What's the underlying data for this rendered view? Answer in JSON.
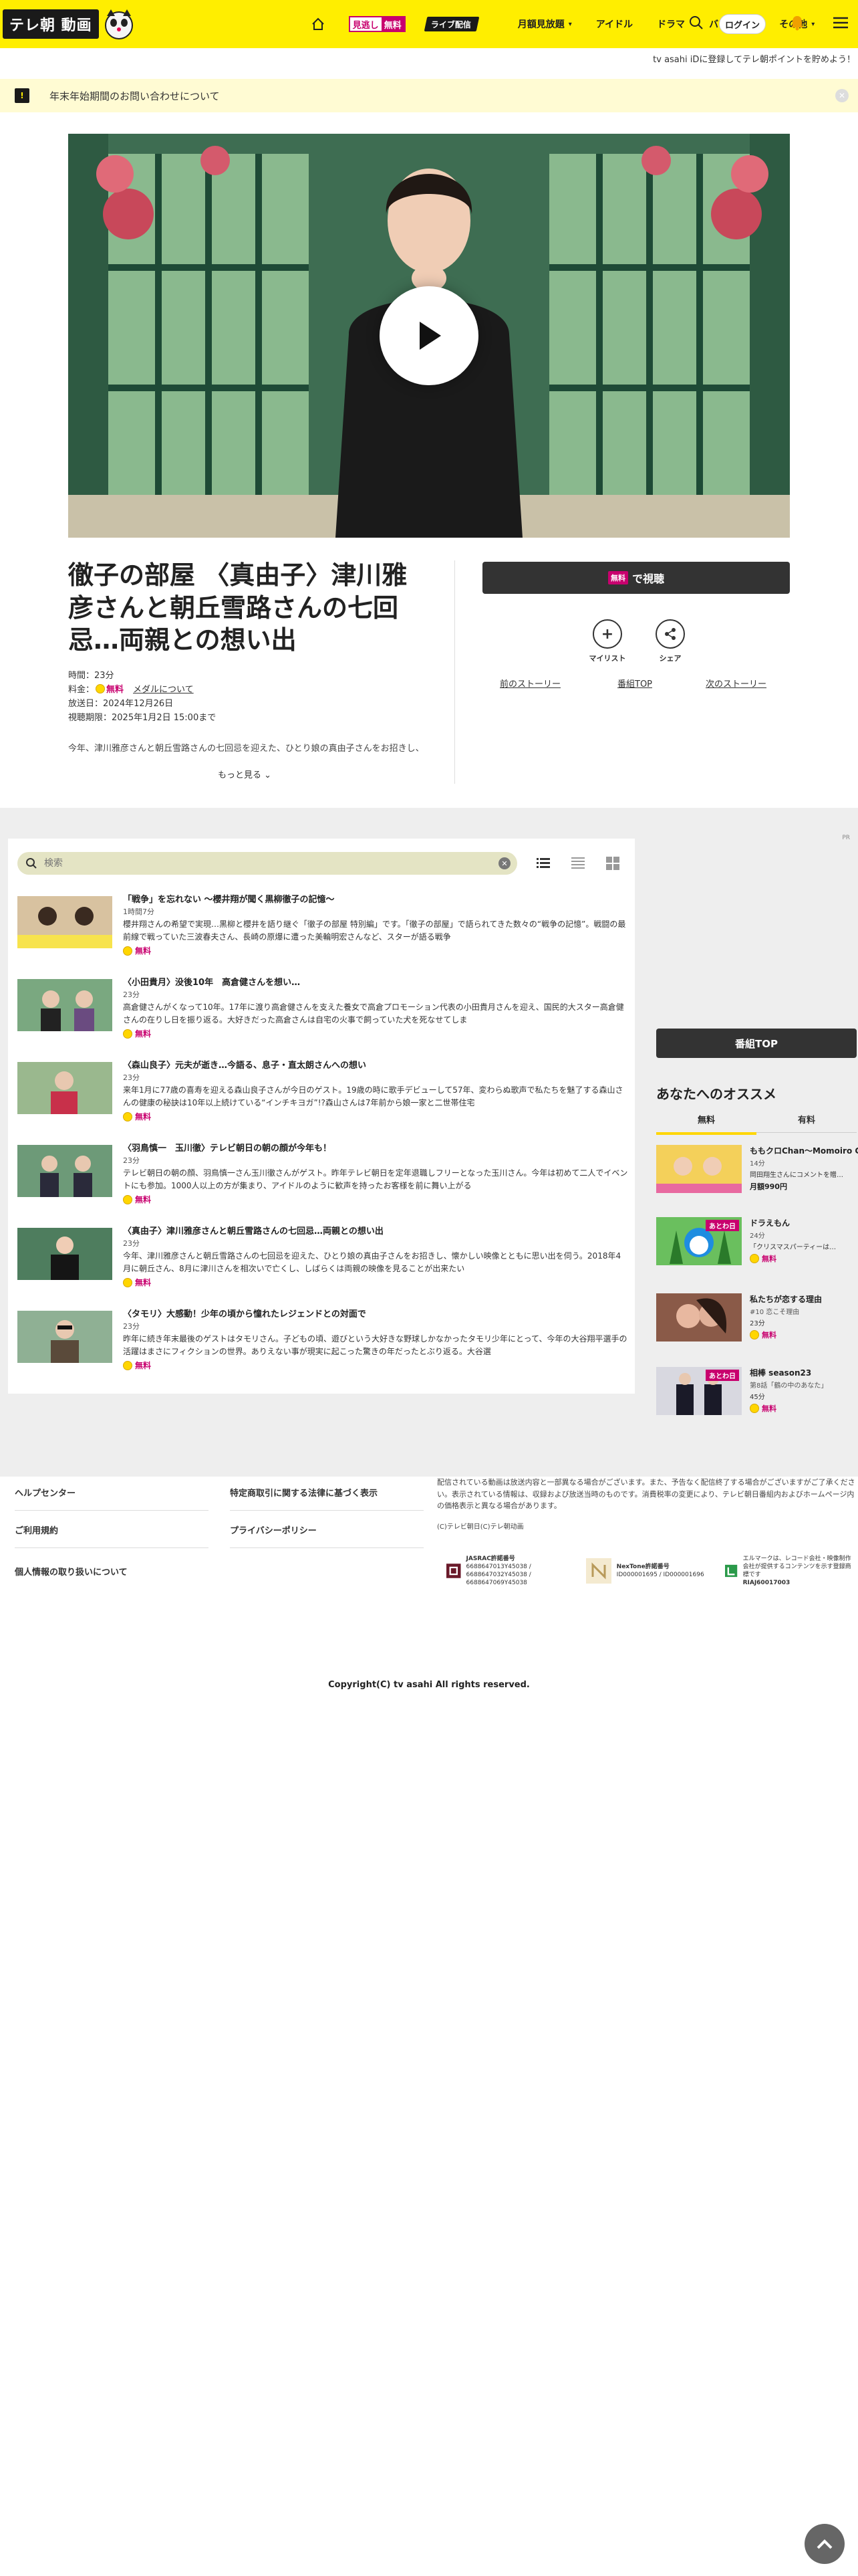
{
  "header": {
    "logo_text": "テレ朝 動画",
    "free_badge_a": "見逃し",
    "free_badge_b": "無料",
    "live_badge": "ライブ配信",
    "nav": [
      "月額見放題",
      "アイドル",
      "ドラマ",
      "バラエティ",
      "その他"
    ],
    "login": "ログイン"
  },
  "register_strip": "tv asahi iDに登録してテレ朝ポイントを貯めよう！",
  "notice": {
    "text": "年末年始期間のお問い合わせについて"
  },
  "episode": {
    "title": "徹子の部屋 〈真由子〉津川雅彦さんと朝丘雪路さんの七回忌…両親との想い出",
    "duration_label": "時間：23分",
    "price_label": "料金：",
    "price_value": "無料",
    "coin_link": "メダルについて",
    "air_date": "放送日：2024年12月26日",
    "deadline": "視聴期限：2025年1月2日 15:00まで",
    "description": "今年、津川雅彦さんと朝丘雪路さんの七回忌を迎えた、ひとり娘の真由子さんをお招きし、",
    "more": "もっと見る"
  },
  "actions": {
    "watch_badge": "無料",
    "watch_label": "で視聴",
    "mylist": "マイリスト",
    "share": "シェア",
    "prev": "前のストーリー",
    "top": "番組TOP",
    "next": "次のストーリー"
  },
  "pr_label": "PR",
  "search": {
    "placeholder": "検索"
  },
  "episodes": [
    {
      "title": "「戦争」を忘れない ～櫻井翔が聞く黒柳徹子の記憶～",
      "date": "1時間7分",
      "summary": "櫻井翔さんの希望で実現…黒柳と櫻井を語り継ぐ「徹子の部屋 特別編」です。「徹子の部屋」で語られてきた数々の“戦争の記憶”。戦闘の最前線で戦っていた三波春夫さん、長崎の原爆に遭った美輪明宏さんなど、スターが語る戦争",
      "free": "無料"
    },
    {
      "title": "〈小田貴月〉没後10年　高倉健さんを想い…",
      "date": "23分",
      "summary": "高倉健さんがくなって10年。17年に渡り高倉健さんを支えた養女で高倉プロモーション代表の小田貴月さんを迎え、国民的大スター高倉健さんの在りし日を振り返る。大好きだった高倉さんは自宅の火事で飼っていた犬を死なせてしま",
      "free": "無料"
    },
    {
      "title": "〈森山良子〉元夫が逝き…今語る、息子・直太朗さんへの想い",
      "date": "23分",
      "summary": "来年1月に77歳の喜寿を迎える森山良子さんが今日のゲスト。19歳の時に歌手デビューして57年、変わらぬ歌声で私たちを魅了する森山さんの健康の秘訣は10年以上続けている“インチキヨガ”!?森山さんは7年前から娘一家と二世帯住宅",
      "free": "無料"
    },
    {
      "title": "〈羽鳥慎一　玉川徹〉テレビ朝日の朝の顔が今年も！",
      "date": "23分",
      "summary": "テレビ朝日の朝の顔、羽鳥慎一さん玉川徹さんがゲスト。昨年テレビ朝日を定年退職しフリーとなった玉川さん。今年は初めて二人でイベントにも参加。1000人以上の方が集まり、アイドルのように歓声を持ったお客様を前に舞い上がる",
      "free": "無料"
    },
    {
      "title": "〈真由子〉津川雅彦さんと朝丘雪路さんの七回忌…両親との想い出",
      "date": "23分",
      "summary": "今年、津川雅彦さんと朝丘雪路さんの七回忌を迎えた、ひとり娘の真由子さんをお招きし、懐かしい映像とともに思い出を伺う。2018年4月に朝丘さん、8月に津川さんを相次いで亡くし、しばらくは両親の映像を見ることが出来たい",
      "free": "無料"
    },
    {
      "title": "〈タモリ〉大感動！少年の頃から憧れたレジェンドとの対面で",
      "date": "23分",
      "summary": "昨年に続き年末最後のゲストはタモリさん。子どもの頃、遊びという大好きな野球しかなかったタモリ少年にとって、今年の大谷翔平選手の活躍はまさにフィクションの世界。ありえない事が現実に起こった驚きの年だったとぶり返る。大谷選",
      "free": "無料"
    }
  ],
  "sidebar": {
    "top_button": "番組TOP",
    "reco_title": "あなたへのオススメ",
    "tab_free": "無料",
    "tab_paid": "有料",
    "items": [
      {
        "title": "ももクロChan～Momoiro Clover Z Channel～",
        "date": "14分",
        "sub": "岡田翔生さんにコメントを贈…",
        "price": "月額990円",
        "tag": ""
      },
      {
        "title": "ドラえもん",
        "date": "24分",
        "sub": "「クリスマスパーティーは…",
        "price": "無料",
        "tag": "あとわ日"
      },
      {
        "title": "私たちが恋する理由",
        "date": "#10 恋こそ理由",
        "sub": "23分",
        "price": "無料",
        "tag": ""
      },
      {
        "title": "相棒 season23",
        "date": "第8話「鶴の中のあなた」",
        "sub": "45分",
        "price": "無料",
        "tag": "あとわ日"
      }
    ]
  },
  "footer": {
    "links_left": [
      "ヘルプセンター",
      "ご利用規約",
      "個人情報の取り扱いについて"
    ],
    "links_right": [
      "特定商取引に関する法律に基づく表示",
      "プライバシーポリシー"
    ],
    "note": "配信されている動画は放送内容と一部異なる場合がございます。また、予告なく配信終了する場合がございますがご了承ください。表示されている情報は、収録および放送当時のものです。消費税率の変更により、テレビ朝日番組内およびホームページ内の価格表示と異なる場合があります。",
    "copy_small": "(C)テレビ朝日(C)テレ朝动画",
    "jasrac_title": "JASRAC許諾番号",
    "jasrac_nums": "6688647013Y45038 / 6688647032Y45038 / 6688647069Y45038",
    "nextone_title": "NexTone許諾番号",
    "nextone_nums": "ID000001695 / ID000001696",
    "riaj_text": "エルマークは、レコード会社・映像制作会社が提供するコンテンツを示す登録商標です",
    "riaj_num": "RIAJ60017003",
    "copyright": "Copyright(C) tv asahi All rights reserved."
  }
}
